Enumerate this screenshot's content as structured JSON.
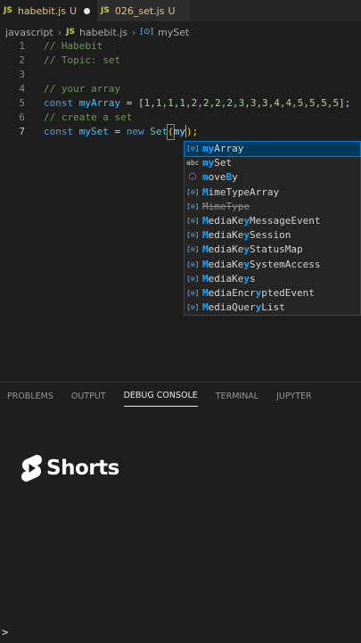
{
  "tabs": [
    {
      "badge": "JS",
      "name": "habebit.js",
      "status": "U",
      "dirty": true
    },
    {
      "badge": "JS",
      "name": "026_set.js",
      "status": "U",
      "dirty": false
    }
  ],
  "breadcrumb": {
    "folder": "javascript",
    "file_badge": "JS",
    "file": "habebit.js",
    "symbol_icon": "[⊙]",
    "symbol": "mySet"
  },
  "code": {
    "line_numbers": [
      "1",
      "2",
      "3",
      "4",
      "5",
      "6",
      "7"
    ],
    "l1_comment": "// Habebit",
    "l2_comment": "// Topic: set",
    "l4_comment": "// your array",
    "l5_kw": "const",
    "l5_var": "myArray",
    "l5_eq": " = [",
    "l5_nums": "1,1,1,1,2,2,2,2,3,3,3,4,4,5,5,5,5",
    "l5_end": "];",
    "l6_comment": "// create a set",
    "l7_kw": "const",
    "l7_var": "mySet",
    "l7_eq": " = ",
    "l7_new": "new",
    "l7_class": "Set",
    "l7_open": "(",
    "l7_typed": "my",
    "l7_close": ");"
  },
  "suggestions": [
    {
      "icon": "[⊙]",
      "match": "my",
      "rest": "Array"
    },
    {
      "icon": "abc",
      "match": "my",
      "rest": "Set"
    },
    {
      "icon": "⬡",
      "pre": "",
      "match": "m",
      "mid": "ove",
      "match2": "B",
      "rest": "y"
    },
    {
      "icon": "[⊙]",
      "match": "M",
      "rest": "imeTypeArray"
    },
    {
      "icon": "[⊙]",
      "match": "M",
      "rest": "imeType"
    },
    {
      "icon": "[⊙]",
      "match": "M",
      "mid": "ediaKe",
      "match2": "y",
      "rest": "MessageEvent"
    },
    {
      "icon": "[⊙]",
      "match": "M",
      "mid": "ediaKe",
      "match2": "y",
      "rest": "Session"
    },
    {
      "icon": "[⊙]",
      "match": "M",
      "mid": "ediaKe",
      "match2": "y",
      "rest": "StatusMap"
    },
    {
      "icon": "[⊙]",
      "match": "M",
      "mid": "ediaKe",
      "match2": "y",
      "rest": "SystemAccess"
    },
    {
      "icon": "[⊙]",
      "match": "M",
      "mid": "ediaKe",
      "match2": "y",
      "rest": "s"
    },
    {
      "icon": "[⊙]",
      "match": "M",
      "mid": "ediaEncr",
      "match2": "y",
      "rest": "ptedEvent"
    },
    {
      "icon": "[⊙]",
      "match": "M",
      "mid": "ediaQuer",
      "match2": "y",
      "rest": "List"
    }
  ],
  "panel_tabs": [
    "PROBLEMS",
    "OUTPUT",
    "DEBUG CONSOLE",
    "TERMINAL",
    "JUPYTER"
  ],
  "shorts_label": "Shorts",
  "terminal_prompt": ">",
  "colors": {
    "selection": "#04395e",
    "match_highlight": "#18a3ff",
    "shorts_logo": "#ffffff"
  }
}
